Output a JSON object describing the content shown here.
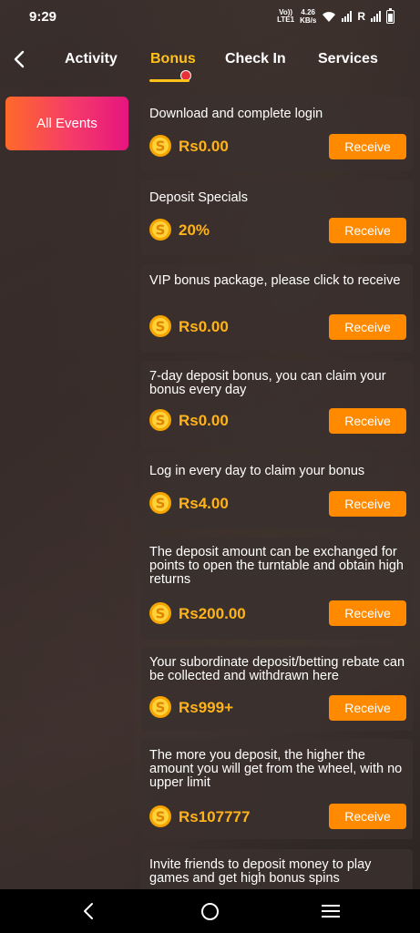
{
  "status_bar": {
    "time": "9:29",
    "volte_top": "Vo))",
    "volte_bottom": "LTE1",
    "speed_value": "4.26",
    "speed_unit": "KB/s",
    "roaming": "R"
  },
  "nav": {
    "tabs": [
      {
        "label": "Activity"
      },
      {
        "label": "Bonus"
      },
      {
        "label": "Check In"
      },
      {
        "label": "Services"
      }
    ],
    "active_tab": "Bonus",
    "accent_color": "#ffc21a",
    "notification_dot_color": "#e8323a"
  },
  "sidebar": {
    "items": [
      {
        "label": "All Events"
      }
    ]
  },
  "bonus_cards": [
    {
      "title": "Download and complete login",
      "amount": "Rs0.00",
      "button": "Receive"
    },
    {
      "title": "Deposit Specials",
      "amount": "20%",
      "button": "Receive"
    },
    {
      "title": "VIP bonus package, please click to receive",
      "amount": "Rs0.00",
      "button": "Receive"
    },
    {
      "title": "7-day deposit bonus, you can claim your bonus every day",
      "amount": "Rs0.00",
      "button": "Receive"
    },
    {
      "title": "Log in every day to claim your bonus",
      "amount": "Rs4.00",
      "button": "Receive"
    },
    {
      "title": "The deposit amount can be exchanged for points to open the turntable and obtain high returns",
      "amount": "Rs200.00",
      "button": "Receive"
    },
    {
      "title": "Your subordinate deposit/betting rebate can be collected and withdrawn here",
      "amount": "Rs999+",
      "button": "Receive"
    },
    {
      "title": "The more you deposit, the higher the amount you will get from the wheel, with no upper limit",
      "amount": "Rs107777",
      "button": "Receive"
    },
    {
      "title": "Invite friends to deposit money to play games and get high bonus spins",
      "amount": "",
      "button": ""
    }
  ],
  "colors": {
    "button": "#ff8a00",
    "amount": "#ffb31a",
    "sidebar_gradient_start": "#ff6a2a",
    "sidebar_gradient_end": "#e6157f"
  }
}
